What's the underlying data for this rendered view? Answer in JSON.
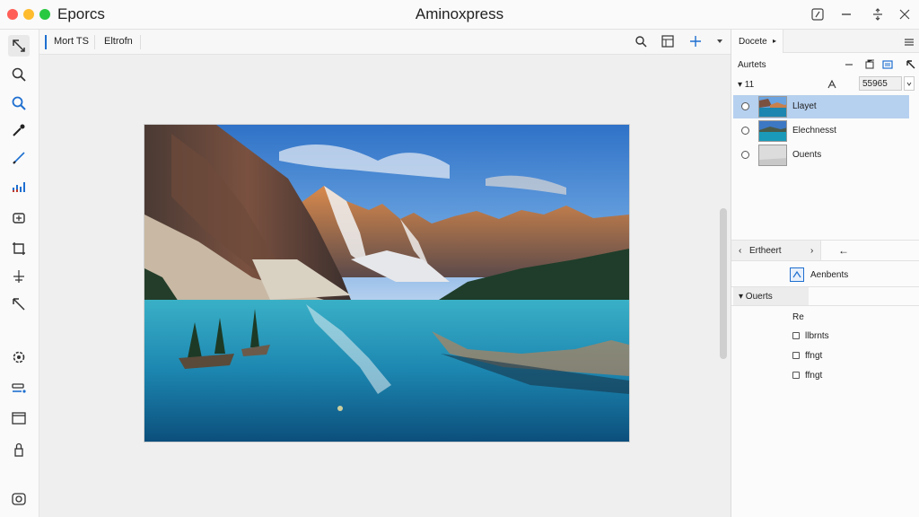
{
  "titlebar": {
    "app_menu": "Eporcs",
    "title": "Aminoxpress",
    "icons": [
      "edit-icon",
      "minimize-icon",
      "swap-icon",
      "more-icon"
    ]
  },
  "toolbar_left": {
    "tools": [
      "move-tool-icon",
      "zoom-tool-icon",
      "search-tool-icon",
      "eyedropper-icon",
      "brush-icon",
      "levels-icon",
      "transform-icon",
      "crop-icon",
      "anchor-icon",
      "arrow-icon",
      "settings-icon",
      "layers-stack-icon",
      "frame-icon",
      "lock-icon",
      "camera-icon"
    ]
  },
  "options_bar": {
    "item1": "Mort TS",
    "item2": "Eltrofn",
    "icons": [
      "search-icon",
      "page-icon",
      "crosshair-icon",
      "dropdown-icon"
    ]
  },
  "panel": {
    "tab": "Docete",
    "tab_arrow": "▸",
    "section": "Aurtets",
    "row_prefix": "▾ 11",
    "value": "55965",
    "layers": [
      {
        "name": "Llayet"
      },
      {
        "name": "Elechnesst"
      },
      {
        "name": "Ouents"
      }
    ],
    "sub_tab": "Ertheert",
    "sub_tab_left": "‹",
    "sub_tab_right": "›",
    "back_arrow": "←",
    "adjustments_label": "Aenbents",
    "group_header": "▾  Ouerts",
    "list_title": "Re",
    "items": [
      "llbrnts",
      "ffngt",
      "ffngt"
    ]
  },
  "colors": {
    "selection": "#b6d0ef",
    "accent": "#1e6fd0",
    "close": "#ff5f57",
    "minimize": "#febc2e",
    "maximize": "#28c840"
  }
}
